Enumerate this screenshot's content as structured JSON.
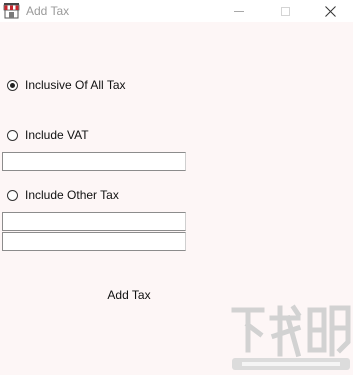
{
  "window": {
    "title": "Add Tax",
    "app_icon": "store-awning-icon",
    "controls": [
      "minimize-icon",
      "maximize-icon",
      "close-icon"
    ]
  },
  "form": {
    "options": [
      {
        "label": "Inclusive Of All Tax",
        "checked": true
      },
      {
        "label": "Include VAT",
        "checked": false
      },
      {
        "label": "Include Other Tax",
        "checked": false
      }
    ],
    "vat_field": {
      "value": ""
    },
    "other_tax_field_1": {
      "value": ""
    },
    "other_tax_field_2": {
      "value": ""
    },
    "add_button_label": "Add Tax"
  },
  "watermark": {
    "text_main": "下载吧",
    "text_url": "www.xiazaiba.com",
    "icon": "xiazaiba-logo"
  },
  "colors": {
    "client_background": "#fdf6f6",
    "title_text": "#9a9a9a"
  }
}
